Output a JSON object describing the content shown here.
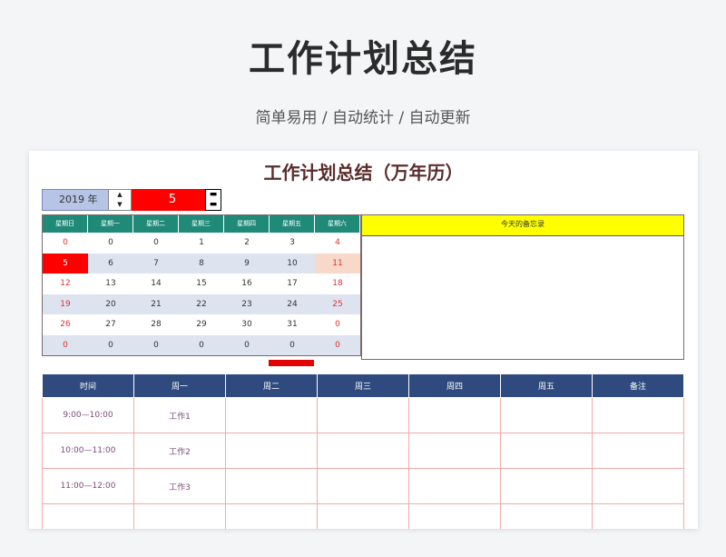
{
  "hero": {
    "title": "工作计划总结",
    "subtitle": "简单易用  /  自动统计  /  自动更新"
  },
  "sheet": {
    "title": "工作计划总结（万年历）",
    "year_label": "2019 年",
    "month_value": "5",
    "spin_up": "▲",
    "spin_down": "▼",
    "month_spin_up": "▬",
    "month_spin_down": "▬",
    "weekdays": [
      "星期日",
      "星期一",
      "星期二",
      "星期三",
      "星期四",
      "星期五",
      "星期六"
    ],
    "calendar_rows": [
      [
        "0",
        "0",
        "0",
        "1",
        "2",
        "3",
        "4"
      ],
      [
        "5",
        "6",
        "7",
        "8",
        "9",
        "10",
        "11"
      ],
      [
        "12",
        "13",
        "14",
        "15",
        "16",
        "17",
        "18"
      ],
      [
        "19",
        "20",
        "21",
        "22",
        "23",
        "24",
        "25"
      ],
      [
        "26",
        "27",
        "28",
        "29",
        "30",
        "31",
        "0"
      ],
      [
        "0",
        "0",
        "0",
        "0",
        "0",
        "0",
        "0"
      ]
    ],
    "notes_title": "今天的备忘录",
    "work_table": {
      "headers": [
        "时间",
        "周一",
        "周二",
        "周三",
        "周四",
        "周五",
        "备注"
      ],
      "rows": [
        [
          "9:00—10:00",
          "工作1",
          "",
          "",
          "",
          "",
          ""
        ],
        [
          "10:00—11:00",
          "工作2",
          "",
          "",
          "",
          "",
          ""
        ],
        [
          "11:00—12:00",
          "工作3",
          "",
          "",
          "",
          "",
          ""
        ],
        [
          "",
          "",
          "",
          "",
          "",
          "",
          ""
        ]
      ]
    }
  },
  "colors": {
    "weekday_header": "#1f8a78",
    "today": "#ff0000",
    "notes_header": "#ffff00",
    "work_header": "#2f4a7e"
  }
}
